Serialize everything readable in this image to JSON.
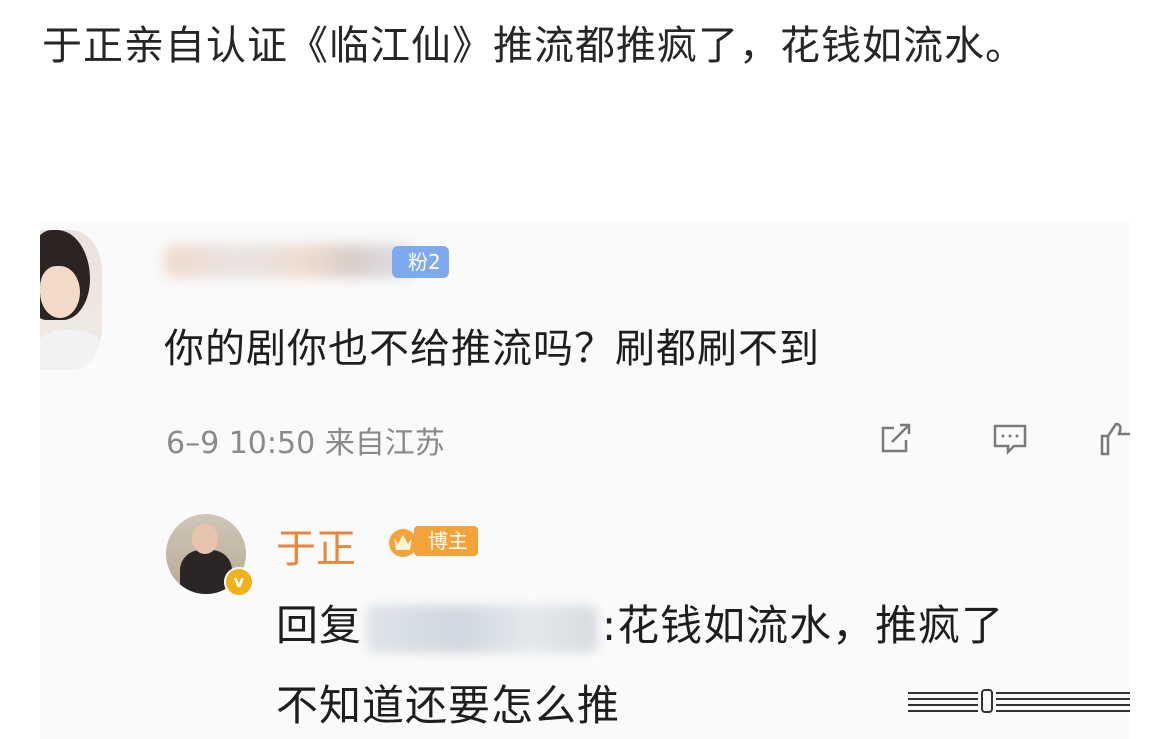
{
  "post": {
    "title": "于正亲自认证《临江仙》推流都推疯了，花钱如流水。"
  },
  "comment": {
    "badge": "粉2",
    "text": "你的剧你也不给推流吗？刷都刷不到",
    "meta": "6–9 10:50 来自江苏",
    "actions": [
      "share-icon",
      "comment-icon",
      "like-icon"
    ]
  },
  "reply": {
    "name": "于正",
    "badge": "博主",
    "prefix": "回复",
    "line1_suffix": ":花钱如流水，推疯了",
    "line2": "不知道还要怎么推"
  },
  "colors": {
    "name_orange": "#e8873a",
    "badge_blue": "#7fa9ef",
    "badge_orange": "#f3a33a",
    "meta_gray": "#8a8a8a"
  }
}
